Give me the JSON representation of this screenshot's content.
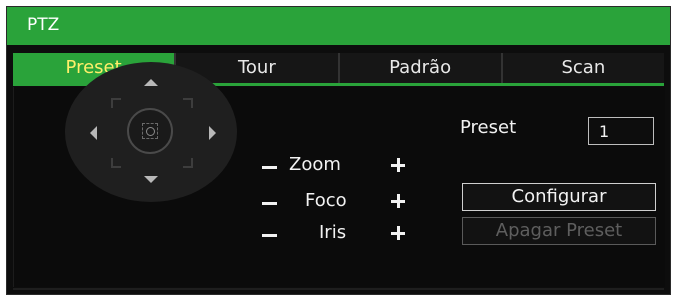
{
  "window": {
    "title": "PTZ"
  },
  "tabs": [
    {
      "label": "Preset",
      "active": true
    },
    {
      "label": "Tour",
      "active": false
    },
    {
      "label": "Padrão",
      "active": false
    },
    {
      "label": "Scan",
      "active": false
    }
  ],
  "controls": {
    "zoom_label": "Zoom",
    "focus_label": "Foco",
    "iris_label": "Iris"
  },
  "preset": {
    "label": "Preset",
    "value": "1"
  },
  "buttons": {
    "configure": "Configurar",
    "delete_preset": "Apagar Preset"
  },
  "colors": {
    "accent": "#2aa33a",
    "active_tab_text": "#ffef6a",
    "background": "#0b0b0b",
    "disabled_text": "#5e5e5e"
  }
}
